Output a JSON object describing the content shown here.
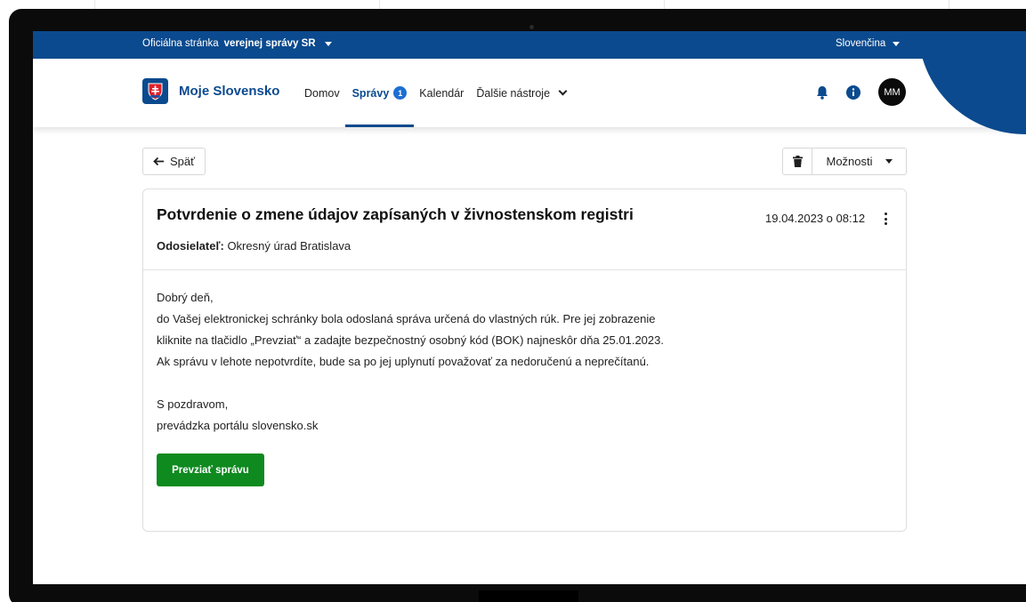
{
  "gov_bar": {
    "official_prefix": "Oficiálna stránka",
    "official_bold": "verejnej správy SR",
    "language": "Slovenčina"
  },
  "header": {
    "logo_text": "Moje Slovensko",
    "nav": [
      {
        "label": "Domov"
      },
      {
        "label": "Správy",
        "badge": "1",
        "active": true
      },
      {
        "label": "Kalendár"
      },
      {
        "label": "Ďalšie nástroje"
      }
    ],
    "avatar_initials": "MM",
    "icons": [
      "bell-icon",
      "info-icon"
    ]
  },
  "toolbar": {
    "back_label": "Späť",
    "options_label": "Možnosti"
  },
  "message": {
    "title": "Potvrdenie o zmene údajov zapísaných v živnostenskom registri",
    "date": "19.04.2023 o 08:12",
    "sender_label": "Odosielateľ:",
    "sender_value": "Okresný úrad Bratislava",
    "body": [
      "Dobrý deň,",
      "do Vašej elektronickej schránky bola odoslaná správa určená do vlastných rúk. Pre jej zobrazenie",
      "kliknite na  tlačidlo „Prevziať“ a zadajte bezpečnostný osobný kód (BOK) najneskôr dňa 25.01.2023.",
      "Ak správu v lehote nepotvrdíte, bude sa po jej uplynutí považovať za nedoručenú a neprečítanú."
    ],
    "closing": [
      "S pozdravom,",
      "prevádzka portálu slovensko.sk"
    ],
    "accept_button": "Prevziať správu"
  },
  "colors": {
    "brand_blue": "#0b4a8e",
    "badge_blue": "#1c6fd1",
    "accept_green": "#0e8a1f"
  }
}
